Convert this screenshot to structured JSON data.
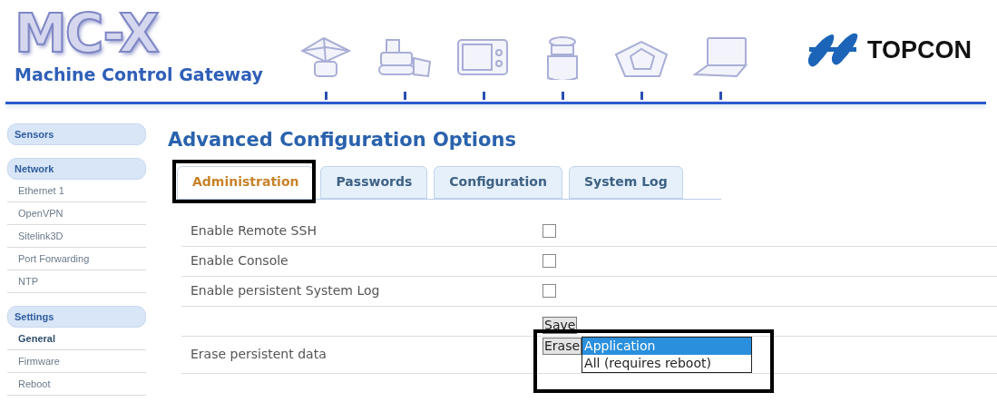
{
  "header": {
    "logo_title": "MC-X",
    "subtitle": "Machine Control Gateway",
    "brand": "TOPCON"
  },
  "sidebar": [
    {
      "label": "Sensors"
    },
    {
      "label": "Network",
      "items": [
        {
          "label": "Ethernet 1",
          "selected": false
        },
        {
          "label": "OpenVPN",
          "selected": false
        },
        {
          "label": "Sitelink3D",
          "selected": false
        },
        {
          "label": "Port Forwarding",
          "selected": false
        },
        {
          "label": "NTP",
          "selected": false
        }
      ]
    },
    {
      "label": "Settings",
      "items": [
        {
          "label": "General",
          "selected": true
        },
        {
          "label": "Firmware",
          "selected": false
        },
        {
          "label": "Reboot",
          "selected": false
        }
      ]
    }
  ],
  "title": "Advanced Configuration Options",
  "tabs": [
    {
      "label": "Administration",
      "selected": true
    },
    {
      "label": "Passwords",
      "selected": false
    },
    {
      "label": "Configuration",
      "selected": false
    },
    {
      "label": "System Log",
      "selected": false
    }
  ],
  "rows": [
    {
      "kind": "checkbox",
      "label": "Enable Remote SSH",
      "checked": false
    },
    {
      "kind": "checkbox",
      "label": "Enable Console",
      "checked": false
    },
    {
      "kind": "checkbox",
      "label": "Enable persistent System Log",
      "checked": false
    },
    {
      "kind": "button",
      "button": "Save"
    },
    {
      "kind": "erase",
      "label": "Erase persistent data",
      "button": "Erase",
      "options": [
        {
          "label": "Application",
          "selected": true
        },
        {
          "label": "All (requires reboot)",
          "selected": false
        }
      ]
    }
  ]
}
